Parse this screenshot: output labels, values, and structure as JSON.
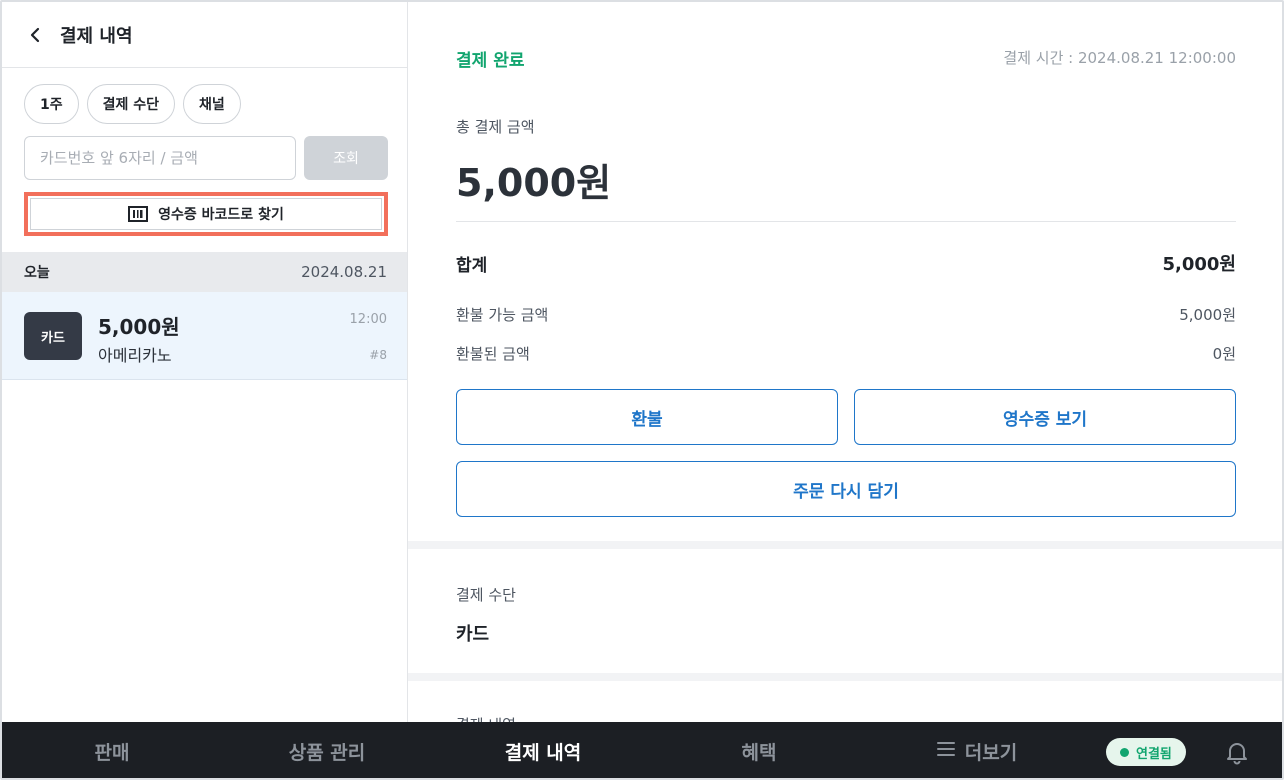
{
  "left_panel": {
    "title": "결제 내역",
    "chips": [
      "1주",
      "결제 수단",
      "채널"
    ],
    "search": {
      "placeholder": "카드번호 앞 6자리 / 금액",
      "value": "",
      "button_label": "조회"
    },
    "barcode_button_label": "영수증 바코드로 찾기",
    "date_group": {
      "label": "오늘",
      "date": "2024.08.21"
    },
    "transactions": [
      {
        "badge": "카드",
        "amount": "5,000원",
        "item": "아메리카노",
        "time": "12:00",
        "number": "#8"
      }
    ]
  },
  "detail": {
    "status": "결제 완료",
    "payment_time": "결제 시간 : 2024.08.21 12:00:00",
    "total_label": "총 결제 금액",
    "total_amount": "5,000원",
    "summary": [
      {
        "label": "합계",
        "value": "5,000원"
      },
      {
        "label": "환불 가능 금액",
        "value": "5,000원"
      },
      {
        "label": "환불된 금액",
        "value": "0원"
      }
    ],
    "buttons": {
      "refund": "환불",
      "view_receipt": "영수증 보기",
      "reorder": "주문 다시 담기"
    },
    "payment_method_label": "결제 수단",
    "payment_method_value": "카드",
    "history_label": "결제 내역"
  },
  "bottom_nav": {
    "items": [
      "판매",
      "상품 관리",
      "결제 내역",
      "혜택",
      "더보기"
    ],
    "active": "결제 내역",
    "connection_status": "연결됨"
  },
  "colors": {
    "accent_blue": "#1f76c9",
    "success_green": "#12a56f",
    "highlight_red": "#f26f5b",
    "nav_bg": "#1c1f24"
  }
}
